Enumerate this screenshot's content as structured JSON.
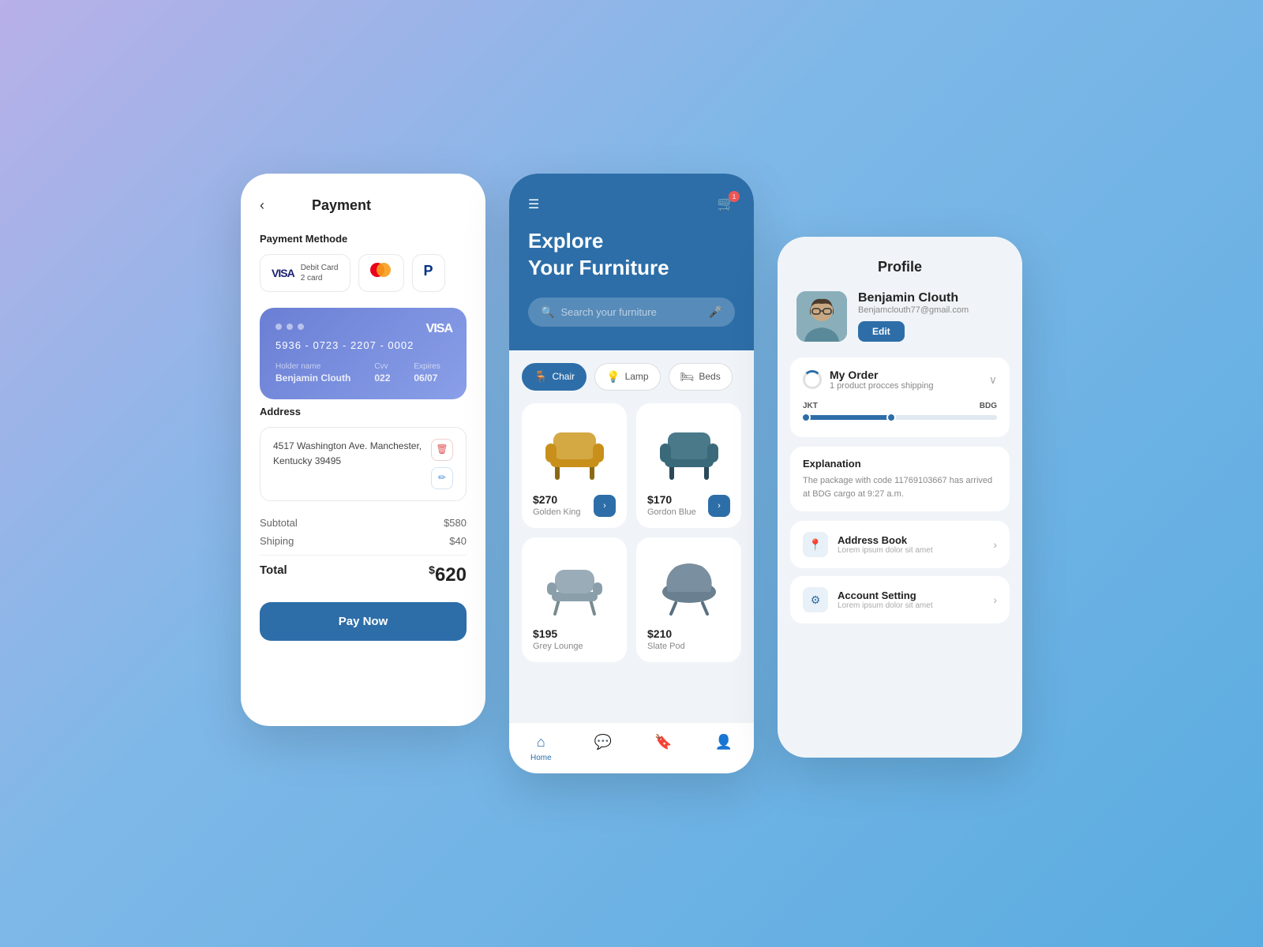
{
  "background": {
    "gradient": "linear-gradient(135deg, #b8b0e8 0%, #7fb8e8 40%, #5aace0 100%)"
  },
  "payment": {
    "title": "Payment",
    "back_label": "‹",
    "payment_methods_label": "Payment Methode",
    "methods": [
      {
        "type": "visa",
        "label": "Debit Card",
        "sublabel": "2 card"
      },
      {
        "type": "mastercard"
      },
      {
        "type": "paypal"
      }
    ],
    "card": {
      "number": "5936 - 0723 - 2207 - 0002",
      "holder_label": "Holder name",
      "holder": "Benjamin Clouth",
      "cvv_label": "Cvv",
      "cvv": "022",
      "expires_label": "Expires",
      "expires": "06/07",
      "brand": "VISA"
    },
    "address_label": "Address",
    "address": "4517 Washington Ave. Manchester, Kentucky 39495",
    "subtotal_label": "Subtotal",
    "subtotal": "$580",
    "shipping_label": "Shiping",
    "shipping": "$40",
    "total_label": "Total",
    "total_symbol": "$",
    "total": "620",
    "pay_btn": "Pay Now"
  },
  "explore": {
    "title_line1": "Explore",
    "title_line2": "Your Furniture",
    "search_placeholder": "Search your furniture",
    "categories": [
      {
        "label": "Chair",
        "icon": "🪑",
        "active": true
      },
      {
        "label": "Lamp",
        "icon": "🪔",
        "active": false
      },
      {
        "label": "Beds",
        "icon": "🛏",
        "active": false
      }
    ],
    "products": [
      {
        "name": "Golden King",
        "price": "$270",
        "color": "#d4a843"
      },
      {
        "name": "Gordon Blue",
        "price": "$170",
        "color": "#4a7a8a"
      },
      {
        "name": "Grey Lounge",
        "price": "$195",
        "color": "#9aacb8"
      },
      {
        "name": "Slate Pod",
        "price": "$210",
        "color": "#7a8fa0"
      }
    ],
    "nav": [
      {
        "label": "Home",
        "icon": "⌂",
        "active": true
      },
      {
        "label": "Chat",
        "icon": "☐",
        "active": false
      },
      {
        "label": "Saved",
        "icon": "🔖",
        "active": false
      },
      {
        "label": "Profile",
        "icon": "👤",
        "active": false
      }
    ]
  },
  "profile": {
    "title": "Profile",
    "name": "Benjamin Clouth",
    "email": "Benjamclouth77@gmail.com",
    "edit_btn": "Edit",
    "order": {
      "label": "My Order",
      "sublabel": "1 product procces shipping",
      "track_start": "JKT",
      "track_end": "BDG",
      "progress": 45
    },
    "explanation": {
      "title": "Explanation",
      "text": "The package with code 11769103667 has arrived at BDG cargo at 9:27 a.m."
    },
    "menu": [
      {
        "label": "Address Book",
        "sublabel": "Lorem ipsum dolor sit amet",
        "icon": "📍"
      },
      {
        "label": "Account Setting",
        "sublabel": "Lorem ipsum dolor sit amet",
        "icon": "⚙"
      }
    ]
  }
}
